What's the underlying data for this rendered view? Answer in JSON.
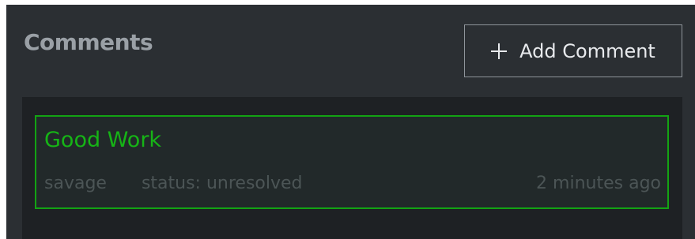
{
  "header": {
    "title": "Comments",
    "add_button": {
      "icon": "plus-icon",
      "label": "Add Comment"
    }
  },
  "comments": [
    {
      "title": "Good Work",
      "author": "savage",
      "status": "status: unresolved",
      "time": "2 minutes ago"
    }
  ],
  "colors": {
    "panel_bg": "#2b2f33",
    "list_bg": "#1e2124",
    "accent_green": "#16b416",
    "title_gray": "#9aa0a6"
  }
}
